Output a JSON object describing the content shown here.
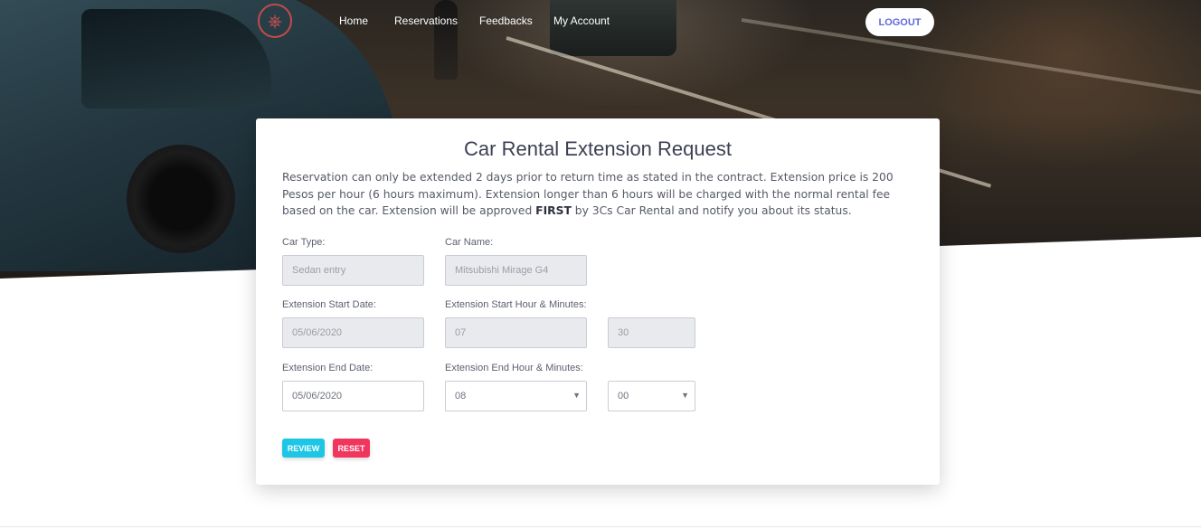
{
  "nav": {
    "items": [
      {
        "label": "Home"
      },
      {
        "label": "Reservations"
      },
      {
        "label": "Feedbacks"
      },
      {
        "label": "My Account"
      }
    ],
    "logout_label": "LOGOUT"
  },
  "form": {
    "title": "Car Rental Extension Request",
    "description_part1": "Reservation can only be extended 2 days prior to return time as stated in the contract. Extension price is 200 Pesos per hour (6 hours maximum). Extension longer than 6 hours will be charged with the normal rental fee based on the car. Extension will be approved ",
    "description_bold": "FIRST",
    "description_part2": " by 3Cs Car Rental and notify you about its status.",
    "car_type_label": "Car Type:",
    "car_type_value": "Sedan entry",
    "car_name_label": "Car Name:",
    "car_name_value": "Mitsubishi Mirage G4",
    "ext_start_date_label": "Extension Start Date:",
    "ext_start_date_value": "05/06/2020",
    "ext_start_time_label": "Extension Start Hour & Minutes:",
    "ext_start_hour_value": "07",
    "ext_start_minute_value": "30",
    "ext_end_date_label": "Extension End Date:",
    "ext_end_date_value": "05/06/2020",
    "ext_end_time_label": "Extension End Hour & Minutes:",
    "ext_end_hour_value": "08",
    "ext_end_minute_value": "00",
    "review_label": "REVIEW",
    "reset_label": "RESET"
  },
  "icons": {
    "logo": "steering-wheel-logo",
    "dropdown": "caret-down-icon"
  },
  "colors": {
    "logout_text": "#5f6bd8",
    "review_button": "#1ec6e6",
    "reset_button": "#f0355e",
    "disabled_field": "#e8eaed"
  }
}
